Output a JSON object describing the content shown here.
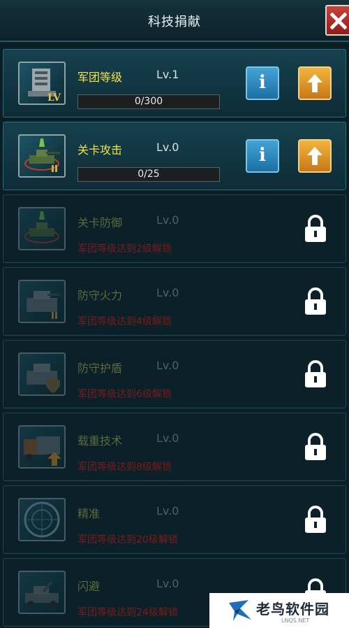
{
  "header": {
    "title": "科技捐献",
    "close_icon": "close-x-icon"
  },
  "colors": {
    "accent_title": "#f2e24a",
    "lock_red": "#7a1d18",
    "info_blue": "#2f8bc2",
    "upgrade_orange": "#e39a2a"
  },
  "items": [
    {
      "name": "军团等级",
      "level": "Lv.1",
      "progress_text": "0/300",
      "progress": 0.0,
      "locked": false,
      "icon": "armored-building-lv-icon"
    },
    {
      "name": "关卡攻击",
      "level": "Lv.0",
      "progress_text": "0/25",
      "progress": 0.0,
      "locked": false,
      "icon": "tank-attack-icon"
    },
    {
      "name": "关卡防御",
      "level": "Lv.0",
      "unlock_text": "军团等级达到2级解锁",
      "locked": true,
      "icon": "tank-defense-icon"
    },
    {
      "name": "防守火力",
      "level": "Lv.0",
      "unlock_text": "军团等级达到4级解锁",
      "locked": true,
      "icon": "bunker-firepower-icon"
    },
    {
      "name": "防守护盾",
      "level": "Lv.0",
      "unlock_text": "军团等级达到6级解锁",
      "locked": true,
      "icon": "bunker-shield-icon"
    },
    {
      "name": "载重技术",
      "level": "Lv.0",
      "unlock_text": "军团等级达到8级解锁",
      "locked": true,
      "icon": "truck-load-icon"
    },
    {
      "name": "精准",
      "level": "Lv.0",
      "unlock_text": "军团等级达到20级解锁",
      "locked": true,
      "icon": "radar-precision-icon"
    },
    {
      "name": "闪避",
      "level": "Lv.0",
      "unlock_text": "军团等级达到24级解锁",
      "locked": true,
      "icon": "artillery-evade-icon"
    }
  ],
  "watermark": {
    "text": "老鸟软件园",
    "sub": "LNQS.NET"
  }
}
